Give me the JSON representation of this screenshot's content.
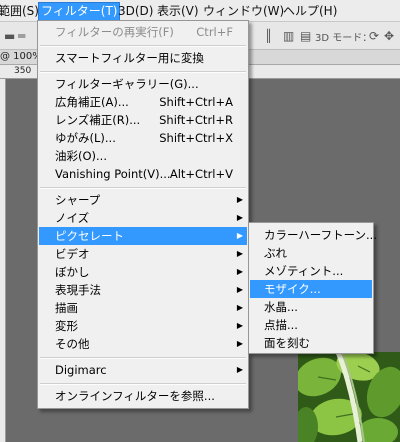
{
  "menubar": {
    "items": [
      "範囲(S)",
      "フィルター(T)",
      "3D(D)",
      "表示(V)",
      "ウィンドウ(W)",
      "ヘルプ(H)"
    ],
    "active_index": 1
  },
  "options_bar": {
    "mode_label": "3D モード："
  },
  "tab": {
    "zoom": "@ 100%"
  },
  "ruler": {
    "first_label": "350"
  },
  "filter_menu": {
    "items": [
      {
        "label": "フィルターの再実行(F)",
        "shortcut": "Ctrl+F",
        "disabled": true
      },
      {
        "label": "スマートフィルター用に変換"
      },
      {
        "label": "フィルターギャラリー(G)..."
      },
      {
        "label": "広角補正(A)...",
        "shortcut": "Shift+Ctrl+A"
      },
      {
        "label": "レンズ補正(R)...",
        "shortcut": "Shift+Ctrl+R"
      },
      {
        "label": "ゆがみ(L)...",
        "shortcut": "Shift+Ctrl+X"
      },
      {
        "label": "油彩(O)..."
      },
      {
        "label": "Vanishing Point(V)...",
        "shortcut": "Alt+Ctrl+V"
      },
      {
        "label": "シャープ",
        "submenu": true
      },
      {
        "label": "ノイズ",
        "submenu": true
      },
      {
        "label": "ピクセレート",
        "submenu": true,
        "highlighted": true
      },
      {
        "label": "ビデオ",
        "submenu": true
      },
      {
        "label": "ぼかし",
        "submenu": true
      },
      {
        "label": "表現手法",
        "submenu": true
      },
      {
        "label": "描画",
        "submenu": true
      },
      {
        "label": "変形",
        "submenu": true
      },
      {
        "label": "その他",
        "submenu": true
      },
      {
        "label": "Digimarc",
        "submenu": true
      },
      {
        "label": "オンラインフィルターを参照..."
      }
    ]
  },
  "pixelate_submenu": {
    "items": [
      {
        "label": "カラーハーフトーン..."
      },
      {
        "label": "ぶれ"
      },
      {
        "label": "メゾティント..."
      },
      {
        "label": "モザイク...",
        "highlighted": true
      },
      {
        "label": "水晶..."
      },
      {
        "label": "点描..."
      },
      {
        "label": "面を刻む"
      }
    ]
  },
  "colors": {
    "highlight": "#3399ff",
    "menu_bg": "#f0f0f0",
    "disabled_text": "#8c8c8c"
  }
}
